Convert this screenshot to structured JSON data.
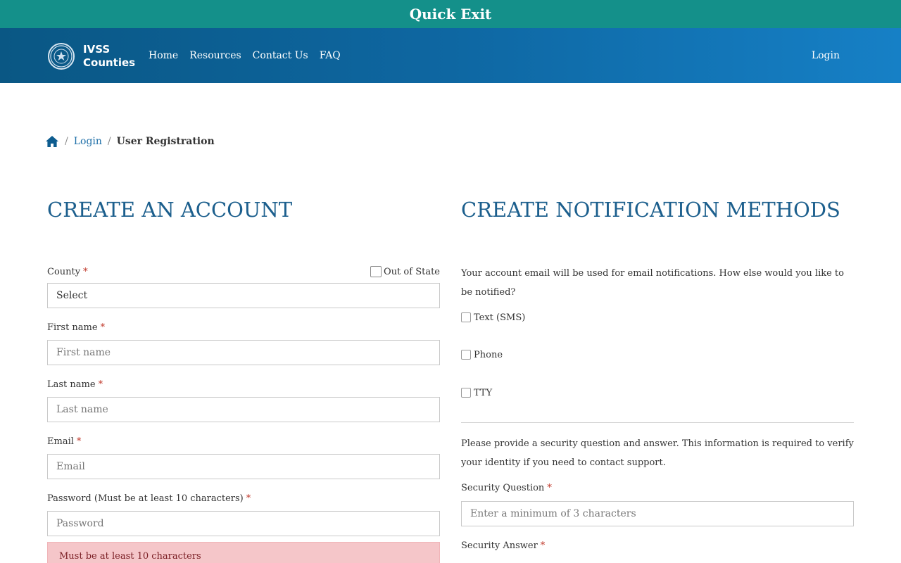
{
  "quick_exit": {
    "label": "Quick Exit"
  },
  "header": {
    "brand": {
      "line1": "IVSS",
      "line2": "Counties"
    },
    "nav": [
      {
        "label": "Home"
      },
      {
        "label": "Resources"
      },
      {
        "label": "Contact Us"
      },
      {
        "label": "FAQ"
      }
    ],
    "login_label": "Login"
  },
  "breadcrumb": {
    "home_icon": "home-icon",
    "items": [
      {
        "label": "Login"
      },
      {
        "label": "User Registration"
      }
    ],
    "separator": "/"
  },
  "account": {
    "title": "CREATE AN ACCOUNT",
    "required_mark": "*",
    "county": {
      "label": "County",
      "value": "Select",
      "out_of_state_label": "Out of State"
    },
    "first_name": {
      "label": "First name",
      "placeholder": "First name"
    },
    "last_name": {
      "label": "Last name",
      "placeholder": "Last name"
    },
    "email": {
      "label": "Email",
      "placeholder": "Email"
    },
    "password": {
      "label": "Password (Must be at least 10 characters)",
      "placeholder": "Password",
      "error": "Must be at least 10 characters"
    }
  },
  "notifications": {
    "title": "CREATE NOTIFICATION METHODS",
    "intro": "Your account email will be used for email notifications. How else would you like to be notified?",
    "methods": [
      {
        "label": "Text (SMS)"
      },
      {
        "label": "Phone"
      },
      {
        "label": "TTY"
      }
    ],
    "security_intro": "Please provide a security question and answer. This information is required to verify your identity if you need to contact support.",
    "security_question": {
      "label": "Security Question",
      "placeholder": "Enter a minimum of 3 characters"
    },
    "security_answer": {
      "label": "Security Answer"
    }
  },
  "colors": {
    "quick_exit_bg": "#14908a",
    "header_gradient_start": "#0a5784",
    "header_gradient_end": "#1680c6",
    "title": "#1c5f8d",
    "link": "#1e6fa8",
    "required": "#c0392b",
    "error_bg": "#f5c6c9"
  }
}
